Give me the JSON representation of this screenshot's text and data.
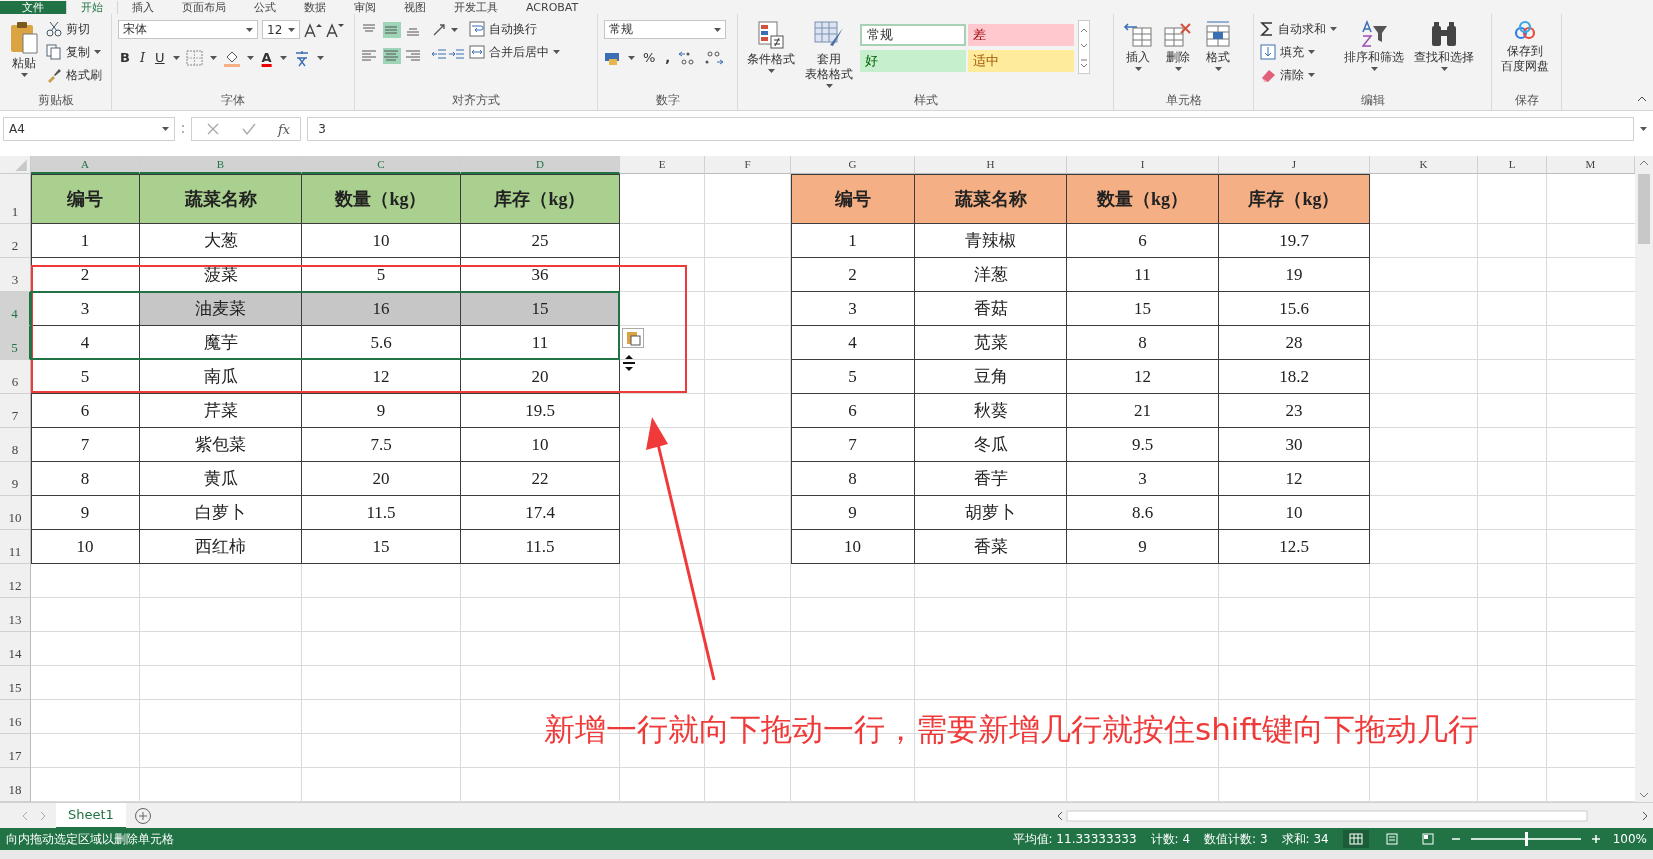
{
  "ribbon_tabs": [
    {
      "label": "文件",
      "selected": false,
      "kind": "file"
    },
    {
      "label": "开始",
      "selected": true,
      "kind": "tab"
    },
    {
      "label": "插入",
      "selected": false,
      "kind": "tab"
    },
    {
      "label": "页面布局",
      "selected": false,
      "kind": "tab"
    },
    {
      "label": "公式",
      "selected": false,
      "kind": "tab"
    },
    {
      "label": "数据",
      "selected": false,
      "kind": "tab"
    },
    {
      "label": "审阅",
      "selected": false,
      "kind": "tab"
    },
    {
      "label": "视图",
      "selected": false,
      "kind": "tab"
    },
    {
      "label": "开发工具",
      "selected": false,
      "kind": "tab"
    },
    {
      "label": "ACROBAT",
      "selected": false,
      "kind": "tab"
    }
  ],
  "ribbon": {
    "clipboard": {
      "label": "剪贴板",
      "paste": "粘贴",
      "cut": "剪切",
      "copy": "复制",
      "format_painter": "格式刷"
    },
    "font": {
      "label": "字体",
      "font_name": "宋体",
      "font_size": "12",
      "bold": "B",
      "italic": "I",
      "underline": "U",
      "font_color": "A"
    },
    "alignment": {
      "label": "对齐方式",
      "wrap_text": "自动换行",
      "merge_center": "合并后居中",
      "vertical": [
        {
          "selected": false
        },
        {
          "selected": true
        },
        {
          "selected": false
        }
      ],
      "horizontal": [
        {
          "selected": false
        },
        {
          "selected": true
        },
        {
          "selected": false
        }
      ]
    },
    "number": {
      "label": "数字",
      "format": "常规",
      "percent": "%",
      "comma": ","
    },
    "styles": {
      "label": "样式",
      "conditional": "条件格式",
      "table_format": [
        "套用",
        "表格格式"
      ],
      "cells": [
        {
          "label": "常规",
          "kind": "normal"
        },
        {
          "label": "差",
          "kind": "bad"
        },
        {
          "label": "好",
          "kind": "good"
        },
        {
          "label": "适中",
          "kind": "neutral"
        }
      ]
    },
    "cells": {
      "label": "单元格",
      "insert": "插入",
      "delete": "删除",
      "format": "格式"
    },
    "editing": {
      "label": "编辑",
      "autosum": "自动求和",
      "fill": "填充",
      "clear": "清除",
      "sort_filter": "排序和筛选",
      "find_select": "查找和选择"
    },
    "save": {
      "label": "保存",
      "button": [
        "保存到",
        "百度网盘"
      ]
    }
  },
  "formula_bar": {
    "name_box": "A4",
    "fx": "fx",
    "formula": "3"
  },
  "sheet": {
    "columns": [
      {
        "label": "A",
        "selected": true
      },
      {
        "label": "B",
        "selected": true
      },
      {
        "label": "C",
        "selected": true
      },
      {
        "label": "D",
        "selected": true
      },
      {
        "label": "E",
        "selected": false
      },
      {
        "label": "F",
        "selected": false
      },
      {
        "label": "G",
        "selected": false
      },
      {
        "label": "H",
        "selected": false
      },
      {
        "label": "I",
        "selected": false
      },
      {
        "label": "J",
        "selected": false
      },
      {
        "label": "K",
        "selected": false
      },
      {
        "label": "L",
        "selected": false
      },
      {
        "label": "M",
        "selected": false
      }
    ],
    "rows": [
      {
        "label": "1",
        "selected": false
      },
      {
        "label": "2",
        "selected": false
      },
      {
        "label": "3",
        "selected": false
      },
      {
        "label": "4",
        "selected": true
      },
      {
        "label": "5",
        "selected": true
      },
      {
        "label": "6",
        "selected": false
      },
      {
        "label": "7",
        "selected": false
      },
      {
        "label": "8",
        "selected": false
      },
      {
        "label": "9",
        "selected": false
      },
      {
        "label": "10",
        "selected": false
      },
      {
        "label": "11",
        "selected": false
      },
      {
        "label": "12",
        "selected": false
      },
      {
        "label": "13",
        "selected": false
      },
      {
        "label": "14",
        "selected": false
      },
      {
        "label": "15",
        "selected": false
      },
      {
        "label": "16",
        "selected": false
      },
      {
        "label": "17",
        "selected": false
      },
      {
        "label": "18",
        "selected": false
      }
    ],
    "tables": [
      {
        "color": "#a9d08e",
        "header": [
          "编号",
          "蔬菜名称",
          "数量（kg）",
          "库存（kg）"
        ],
        "rows": [
          {
            "cells": [
              "1",
              "大葱",
              "10",
              "25"
            ],
            "selected": false,
            "highlighted": false
          },
          {
            "cells": [
              "2",
              "菠菜",
              "5",
              "36"
            ],
            "selected": false,
            "highlighted": false
          },
          {
            "cells": [
              "3",
              "油麦菜",
              "16",
              "15"
            ],
            "selected": true,
            "highlighted": true
          },
          {
            "cells": [
              "4",
              "魔芋",
              "5.6",
              "11"
            ],
            "selected": true,
            "highlighted": false
          },
          {
            "cells": [
              "5",
              "南瓜",
              "12",
              "20"
            ],
            "selected": false,
            "highlighted": false
          },
          {
            "cells": [
              "6",
              "芹菜",
              "9",
              "19.5"
            ],
            "selected": false,
            "highlighted": false
          },
          {
            "cells": [
              "7",
              "紫包菜",
              "7.5",
              "10"
            ],
            "selected": false,
            "highlighted": false
          },
          {
            "cells": [
              "8",
              "黄瓜",
              "20",
              "22"
            ],
            "selected": false,
            "highlighted": false
          },
          {
            "cells": [
              "9",
              "白萝卜",
              "11.5",
              "17.4"
            ],
            "selected": false,
            "highlighted": false
          },
          {
            "cells": [
              "10",
              "西红柿",
              "15",
              "11.5"
            ],
            "selected": false,
            "highlighted": false
          }
        ]
      },
      {
        "color": "#f4b084",
        "header": [
          "编号",
          "蔬菜名称",
          "数量（kg）",
          "库存（kg）"
        ],
        "rows": [
          {
            "cells": [
              "1",
              "青辣椒",
              "6",
              "19.7"
            ],
            "selected": false,
            "highlighted": false
          },
          {
            "cells": [
              "2",
              "洋葱",
              "11",
              "19"
            ],
            "selected": false,
            "highlighted": false
          },
          {
            "cells": [
              "3",
              "香菇",
              "15",
              "15.6"
            ],
            "selected": false,
            "highlighted": false
          },
          {
            "cells": [
              "4",
              "苋菜",
              "8",
              "28"
            ],
            "selected": false,
            "highlighted": false
          },
          {
            "cells": [
              "5",
              "豆角",
              "12",
              "18.2"
            ],
            "selected": false,
            "highlighted": false
          },
          {
            "cells": [
              "6",
              "秋葵",
              "21",
              "23"
            ],
            "selected": false,
            "highlighted": false
          },
          {
            "cells": [
              "7",
              "冬瓜",
              "9.5",
              "30"
            ],
            "selected": false,
            "highlighted": false
          },
          {
            "cells": [
              "8",
              "香芋",
              "3",
              "12"
            ],
            "selected": false,
            "highlighted": false
          },
          {
            "cells": [
              "9",
              "胡萝卜",
              "8.6",
              "10"
            ],
            "selected": false,
            "highlighted": false
          },
          {
            "cells": [
              "10",
              "香菜",
              "9",
              "12.5"
            ],
            "selected": false,
            "highlighted": false
          }
        ]
      }
    ]
  },
  "annotation": {
    "text": "新增一行就向下拖动一行，需要新增几行就按住shift键向下拖动几行"
  },
  "sheet_tabs": [
    {
      "label": "Sheet1",
      "selected": true
    }
  ],
  "status_bar": {
    "message": "向内拖动选定区域以删除单元格",
    "stats": [
      "平均值: 11.33333333",
      "计数: 4",
      "数值计数: 3",
      "求和: 34"
    ],
    "view_modes": [
      {
        "kind": "normal",
        "selected": true
      },
      {
        "kind": "layout",
        "selected": false
      },
      {
        "kind": "pagebreak",
        "selected": false
      }
    ],
    "zoom": {
      "level": 0.5,
      "label": "100%"
    }
  }
}
